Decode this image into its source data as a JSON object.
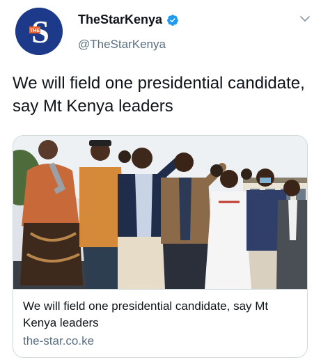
{
  "tweet": {
    "author": {
      "display_name": "TheStarKenya",
      "handle": "@TheStarKenya",
      "verified": true,
      "avatar_icon": "the-star-logo",
      "avatar_text": "THE"
    },
    "menu_icon": "chevron-down-icon",
    "text": "We will field one presidential candidate, say Mt Kenya leaders"
  },
  "card": {
    "image": "photo-of-mt-kenya-leaders-addressing-crowd",
    "title": "We will field one presidential candidate, say Mt Kenya leaders",
    "domain": "the-star.co.ke"
  },
  "colors": {
    "brand_blue": "#1d3a8a",
    "verified_blue": "#1d9bf0",
    "secondary_text": "#5b7083",
    "border": "#cfd9de"
  }
}
